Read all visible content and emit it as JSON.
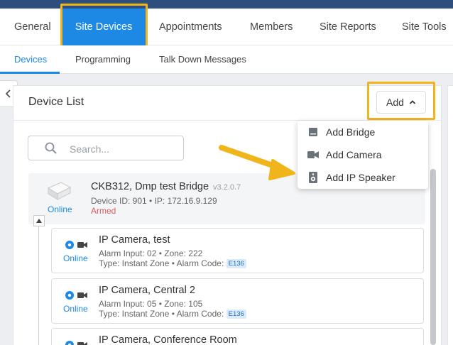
{
  "main_tabs": [
    {
      "label": "General"
    },
    {
      "label": "Site Devices"
    },
    {
      "label": "Appointments"
    },
    {
      "label": "Members"
    },
    {
      "label": "Site Reports"
    },
    {
      "label": "Site Tools"
    }
  ],
  "sub_tabs": [
    {
      "label": "Devices"
    },
    {
      "label": "Programming"
    },
    {
      "label": "Talk Down Messages"
    }
  ],
  "panel": {
    "title": "Device List",
    "add_label": "Add",
    "search_placeholder": "Search..."
  },
  "add_menu": {
    "items": [
      {
        "label": "Add Bridge",
        "icon": "bridge-icon"
      },
      {
        "label": "Add Camera",
        "icon": "camera-icon"
      },
      {
        "label": "Add IP Speaker",
        "icon": "speaker-icon"
      }
    ]
  },
  "bridge": {
    "name": "CKB312, Dmp test Bridge",
    "version": "v3.2.0.7",
    "meta": "Device ID: 901 • IP: 172.16.9.129",
    "status": "Armed",
    "online": "Online"
  },
  "cameras": [
    {
      "name": "IP Camera, test",
      "line1": "Alarm Input: 02 • Zone: 222",
      "type_text": "Type: Instant Zone • Alarm Code:",
      "code": "E136",
      "online": "Online"
    },
    {
      "name": "IP Camera, Central 2",
      "line1": "Alarm Input: 05 • Zone: 105",
      "type_text": "Type: Instant Zone • Alarm Code:",
      "code": "E136",
      "online": "Online"
    },
    {
      "name": "IP Camera, Conference Room"
    }
  ],
  "colors": {
    "accent": "#1e88e5",
    "highlight": "#f1b51c",
    "armed": "#e05a5a"
  }
}
